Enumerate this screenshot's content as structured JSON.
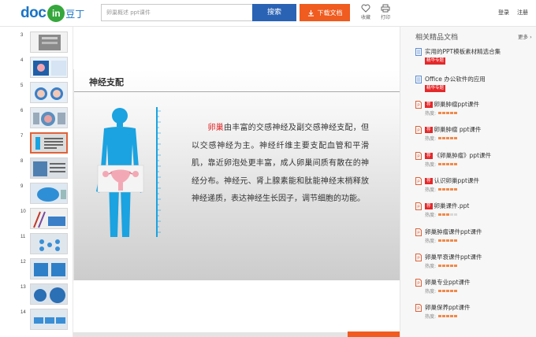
{
  "header": {
    "logo_text": "doc",
    "logo_badge": "in",
    "logo_cn": "豆丁",
    "search_placeholder": "卵巢概述 ppt课件",
    "search_button": "搜索",
    "download_button": "下载文档",
    "collect_label": "收藏",
    "print_label": "打印",
    "login_label": "登录",
    "register_label": "注册"
  },
  "thumbnails": [
    {
      "num": "3"
    },
    {
      "num": "4"
    },
    {
      "num": "5"
    },
    {
      "num": "6"
    },
    {
      "num": "7"
    },
    {
      "num": "8"
    },
    {
      "num": "9"
    },
    {
      "num": "10"
    },
    {
      "num": "11"
    },
    {
      "num": "12"
    },
    {
      "num": "13"
    },
    {
      "num": "14"
    }
  ],
  "active_thumbnail": "7",
  "slide": {
    "title": "神经支配",
    "highlight": "卵巢",
    "body": "由丰富的交感神经及副交感神经支配，但以交感神经为主。神经纤维主要支配血管和平滑肌，靠近卵泡处更丰富，成人卵巢间质有散在的神经分布。神经元、肾上腺素能和肽能神经末梢释放神经递质，表达神经生长因子，调节细胞的功能。"
  },
  "sidebar": {
    "heading": "相关精品文档",
    "more": "更多 ›",
    "heat_label": "热度:",
    "items": [
      {
        "title": "实用的PPT模板素材精选合集",
        "badge": "精华专题",
        "type": "doc"
      },
      {
        "title": "Office 办公软件的应用",
        "badge": "精华专题",
        "type": "doc"
      },
      {
        "tag": "荐",
        "title": "卵巢肿瘤ppt课件",
        "heat": 5,
        "type": "ppt"
      },
      {
        "tag": "荐",
        "title": "卵巢肿瘤 ppt课件",
        "heat": 5,
        "type": "ppt"
      },
      {
        "tag": "荐",
        "title": "《卵巢肿瘤》ppt课件",
        "heat": 5,
        "type": "ppt"
      },
      {
        "tag": "荐",
        "title": "认识卵巢ppt课件",
        "heat": 5,
        "type": "ppt"
      },
      {
        "tag": "荐",
        "title": "卵巢课件.ppt",
        "heat": 3,
        "type": "ppt"
      },
      {
        "title": "卵巢肿瘤课件ppt课件",
        "heat": 5,
        "type": "ppt"
      },
      {
        "title": "卵巢早衰课件ppt课件",
        "heat": 5,
        "type": "ppt"
      },
      {
        "title": "卵巢专业ppt课件",
        "heat": 5,
        "type": "ppt"
      },
      {
        "title": "卵巢保养ppt课件",
        "heat": 5,
        "type": "ppt"
      }
    ]
  },
  "colors": {
    "brand_blue": "#2a63b4",
    "download_orange": "#f05b1f",
    "accent_red": "#e5282a",
    "body_blue": "#1aa3e0"
  }
}
